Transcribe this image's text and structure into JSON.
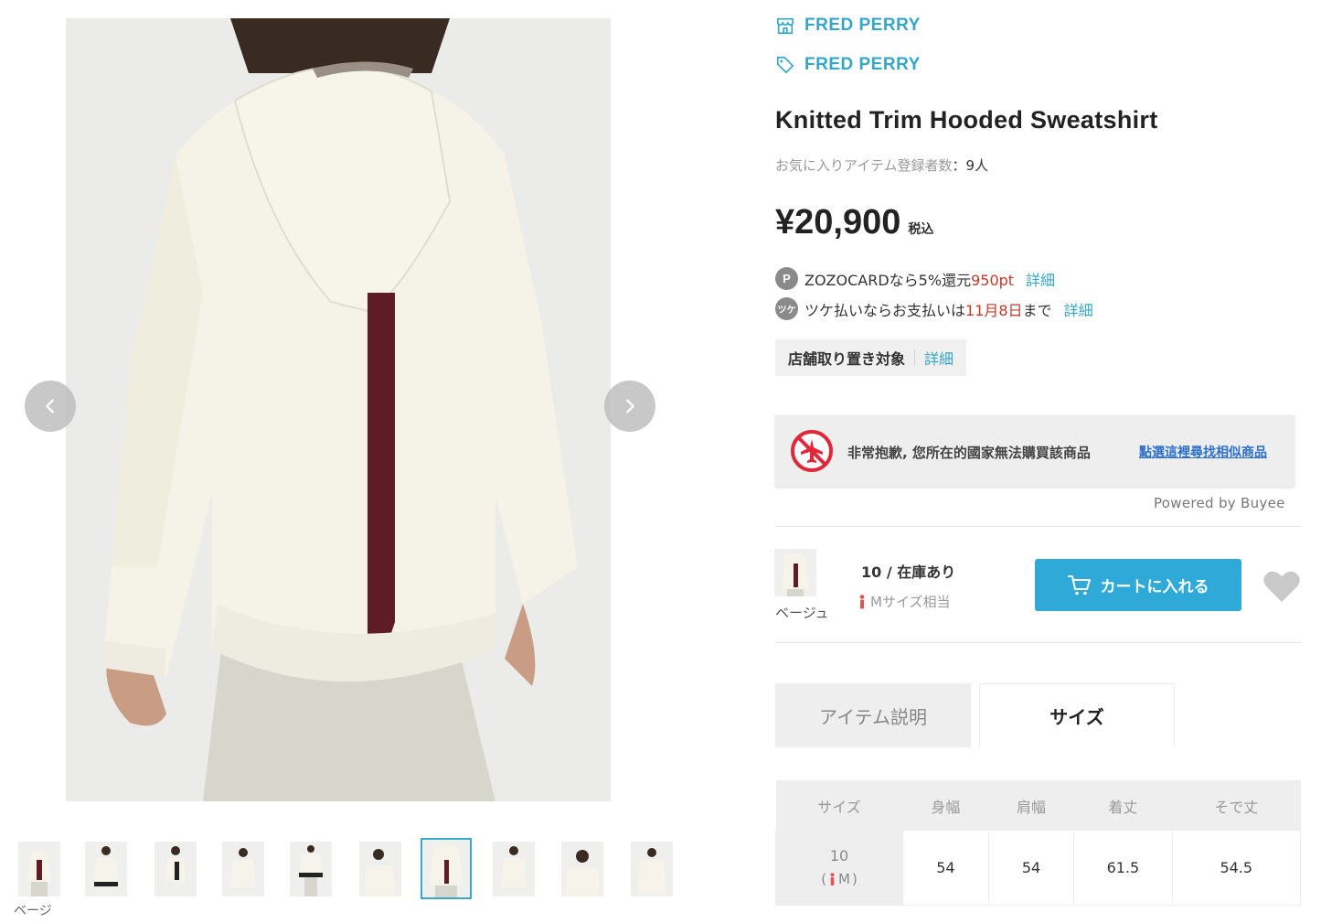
{
  "gallery": {
    "thumbnails": [
      {
        "label": "thumbnail-1"
      },
      {
        "label": "thumbnail-2"
      },
      {
        "label": "thumbnail-3"
      },
      {
        "label": "thumbnail-4"
      },
      {
        "label": "thumbnail-5"
      },
      {
        "label": "thumbnail-6"
      },
      {
        "label": "thumbnail-7",
        "active": true
      },
      {
        "label": "thumbnail-8"
      },
      {
        "label": "thumbnail-9"
      },
      {
        "label": "thumbnail-10"
      }
    ],
    "thumb_caption": "ベージ",
    "icons": {
      "prev": "chevron-left-icon",
      "next": "chevron-right-icon"
    }
  },
  "brand": {
    "shop_name": "FRED PERRY",
    "brand_name": "FRED PERRY",
    "accent_color": "#35a6c7"
  },
  "product": {
    "title": "Knitted Trim Hooded Sweatshirt",
    "fav_label": "お気に入りアイテム登録者数",
    "fav_sep": "：",
    "fav_count": "9人",
    "price": "¥20,900",
    "tax_label": "税込"
  },
  "promos": {
    "zozo": {
      "badge": "P",
      "prefix": "ZOZOCARDなら",
      "rate": "5%",
      "middle": "還元",
      "points": "950pt",
      "link": "詳細"
    },
    "tsuke": {
      "badge": "ツケ",
      "prefix": "ツケ払いならお支払いは",
      "date": "11月8日",
      "suffix": "まで",
      "link": "詳細"
    }
  },
  "store_pickup": {
    "label": "店舗取り置き対象",
    "link": "詳細"
  },
  "notice": {
    "message": "非常抱歉, 您所在的國家無法購買該商品",
    "link": "點選這裡尋找相似商品",
    "powered": "Powered by Buyee"
  },
  "variant": {
    "color": "ベージュ",
    "stock": "10 / 在庫あり",
    "size_equiv": "Mサイズ相当",
    "cart_label": "カートに入れる",
    "cart_color": "#2fa9d7"
  },
  "tabs": [
    {
      "label": "アイテム説明"
    },
    {
      "label": "サイズ"
    }
  ],
  "size_table": {
    "headers": [
      "サイズ",
      "身幅",
      "肩幅",
      "着丈",
      "そで丈"
    ],
    "rows": [
      {
        "size": "10",
        "size_sub": "M",
        "values": [
          "54",
          "54",
          "61.5",
          "54.5"
        ]
      }
    ]
  }
}
